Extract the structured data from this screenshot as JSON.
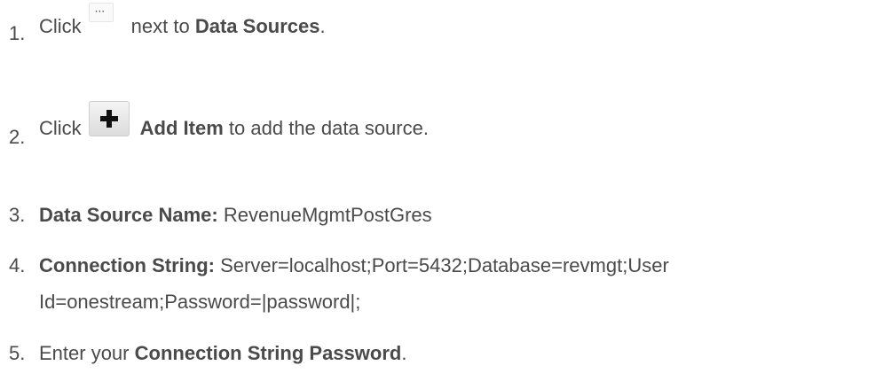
{
  "steps": [
    {
      "number": "1.",
      "prefix": "Click",
      "icon": "more-options-icon",
      "icon_glyph": "···",
      "middle": "next to",
      "bold": "Data Sources",
      "suffix": "."
    },
    {
      "number": "2.",
      "prefix": "Click",
      "icon": "add-item-plus-icon",
      "bold": "Add Item",
      "suffix": "to add the data source."
    },
    {
      "number": "3.",
      "bold": "Data Source Name:",
      "suffix": "RevenueMgmtPostGres"
    },
    {
      "number": "4.",
      "bold": "Connection String:",
      "suffix": "Server=localhost;Port=5432;Database=revmgt;User",
      "continuation": "Id=onestream;Password=|password|;"
    },
    {
      "number": "5.",
      "prefix": "Enter your",
      "bold": "Connection String Password",
      "suffix": "."
    }
  ],
  "colors": {
    "text": "#4a4a4a",
    "icon": "#111111"
  }
}
